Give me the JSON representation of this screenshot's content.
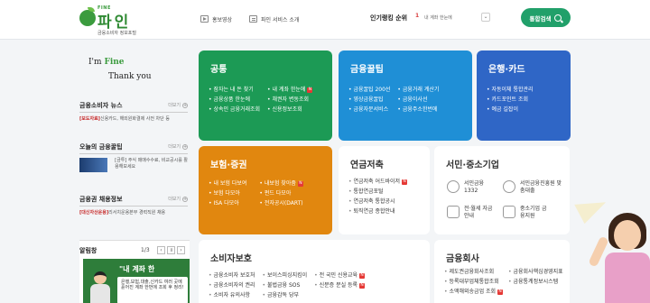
{
  "header": {
    "logo_fine": "FINE",
    "logo_text": "파인",
    "logo_sub": "금융소비자 정보포털",
    "nav": [
      {
        "label": "홍보영상",
        "icon": "play-icon"
      },
      {
        "label": "파인 서비스 소개",
        "icon": "document-icon"
      }
    ],
    "ranking": {
      "label": "인기랭킹 순위",
      "number": "1",
      "item": "내 계좌 한눈에"
    },
    "search_button": "통합검색"
  },
  "left": {
    "slogan_1": "I'm ",
    "slogan_fine": "Fine",
    "slogan_2": "Thank you",
    "more_label": "더보기",
    "news": {
      "title": "금융소비자 뉴스",
      "tag": "[보도자료]",
      "text": "신용카드, 해외원화결제 사전 차단 등"
    },
    "tips": {
      "title": "오늘의 금융꿀팁",
      "text": "[금투] 주식 매매수수료, 비교공시를 활용해보세요"
    },
    "jobs": {
      "title": "금융권 채용정보",
      "tag": "[대신자산운용]",
      "text": "리서치운용본부 경력직원 채용"
    },
    "alarm": {
      "title": "알림창",
      "page": "1/3",
      "banner_title": "\"내 계좌 한",
      "banner_text": "은행,보험,대출,신카드 여러 곳에 흩어진 계좌 한번에 조회 후 정리!"
    }
  },
  "tiles": {
    "loan": {
      "title": "공통",
      "col1": [
        "잠자는 내 돈 찾기",
        "금융상품 한눈에",
        "상속인 금융거래조회"
      ],
      "col2": [
        "내 계좌 한눈에",
        "채권자 변동조회",
        "신용정보조회"
      ],
      "new_badge": "N"
    },
    "tips": {
      "title": "금융꿀팁",
      "col1": [
        "금융꿀팁 200선",
        "영상금융꿀팁",
        "금융자문서비스"
      ],
      "col2": [
        "금융거래 계산기",
        "금융이사선",
        "금융주소한번에"
      ]
    },
    "bank": {
      "title": "은행·카드",
      "items": [
        "자동이체 통합관리",
        "카드포인트 조회",
        "예금 길잡이"
      ]
    },
    "insurance": {
      "title": "보험·증권",
      "col1": [
        "내 보험 다보여",
        "보험 다모아",
        "ISA 다모아"
      ],
      "col2": [
        "내보험 찾아줌",
        "펀드 다모아",
        "전자공시(DART)"
      ]
    },
    "pension": {
      "title": "연금저축",
      "items": [
        "연금저축 어드바이저",
        "통합연금포털",
        "연금저축 통합공시",
        "퇴직연금 종합안내"
      ]
    },
    "smb": {
      "title": "서민·중소기업",
      "services": [
        {
          "label": "서민금융 1332",
          "icon": "phone-icon"
        },
        {
          "label": "서민금융진흥원 맞춤대출",
          "icon": "person-icon"
        },
        {
          "label": "전·월세 자금안내",
          "icon": "house-icon"
        },
        {
          "label": "중소기업 금융지원",
          "icon": "factory-icon"
        }
      ]
    },
    "consumer": {
      "title": "소비자보호",
      "col1": [
        "금융소비자 보호처",
        "금융소비자의 권리",
        "소비자 유의사항"
      ],
      "col2": [
        "보이스피싱지킴이",
        "불법금융 SOS",
        "금융감독 당부"
      ],
      "col3": [
        "전 국민 신용교육",
        "신분증 분실 등록"
      ]
    },
    "company": {
      "title": "금융회사",
      "col1": [
        "제도권금융회사조회",
        "등록대부업체통합조회",
        "소액해외송금업 조회"
      ],
      "col2": [
        "금융회사핵심경영지표",
        "금융통계정보시스템"
      ]
    }
  }
}
